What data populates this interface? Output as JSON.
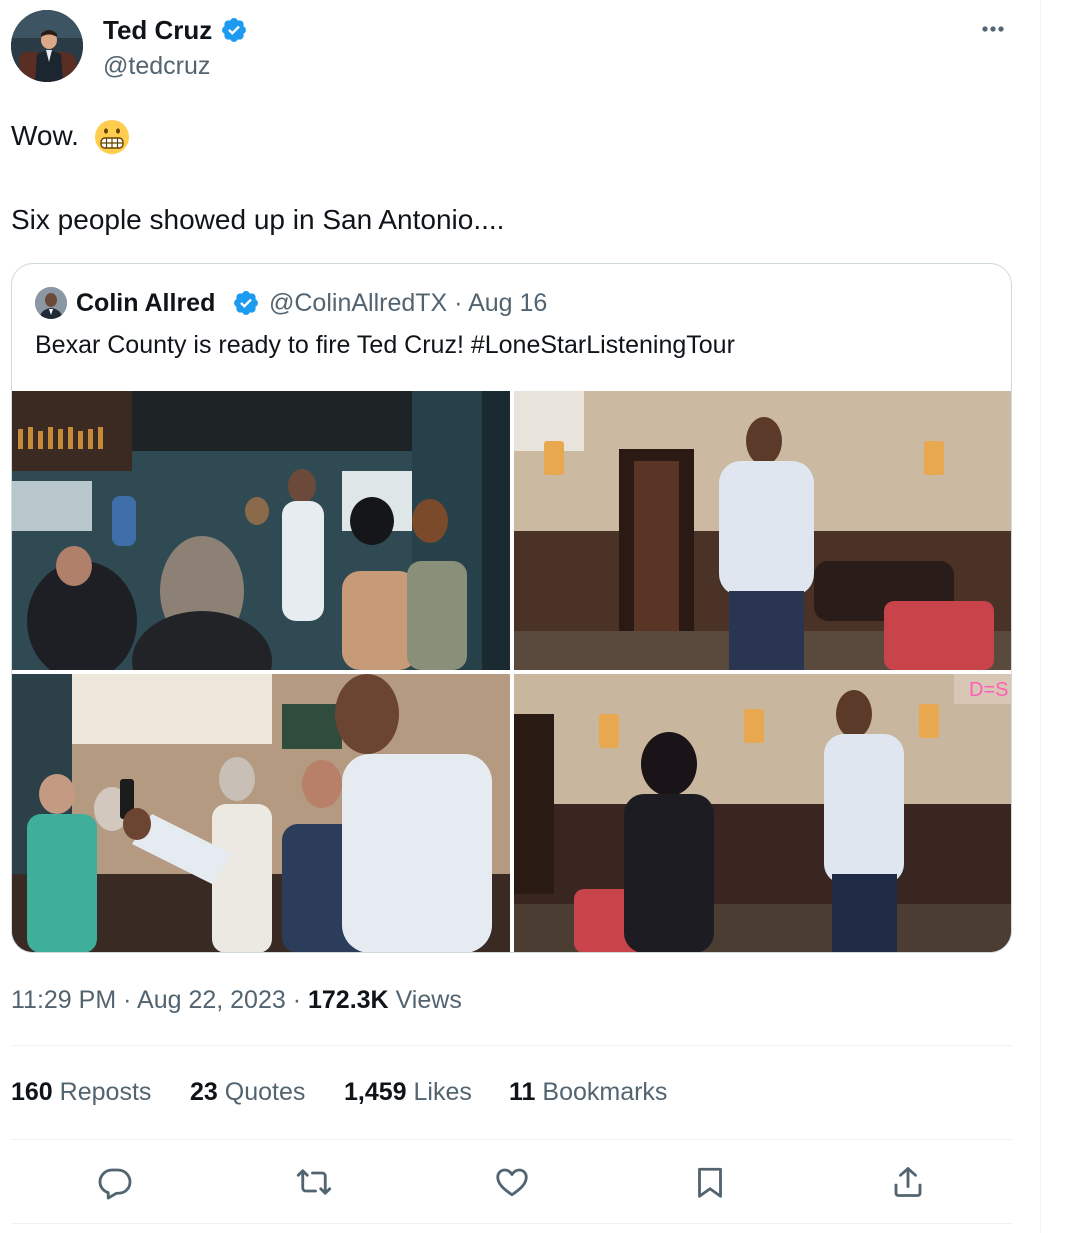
{
  "author": {
    "name": "Ted Cruz",
    "handle": "@tedcruz",
    "verified_color": "#1d9bf0"
  },
  "post": {
    "line1": "Wow.",
    "emoji": "grimacing-face",
    "line2": "Six people showed up in San Antonio...."
  },
  "quote": {
    "name": "Colin Allred",
    "handle": "@ColinAllredTX",
    "separator": "·",
    "date": "Aug 16",
    "text": "Bexar County is ready to fire Ted Cruz! #LoneStarListeningTour",
    "photos": [
      "campaign-event-crowd",
      "allred-speaking",
      "allred-selfie-with-supporters",
      "allred-talking-with-woman"
    ]
  },
  "meta": {
    "time": "11:29 PM",
    "sep1": "·",
    "date": "Aug 22, 2023",
    "sep2": "·",
    "views_count": "172.3K",
    "views_label": "Views"
  },
  "stats": {
    "reposts_count": "160",
    "reposts_label": "Reposts",
    "quotes_count": "23",
    "quotes_label": "Quotes",
    "likes_count": "1,459",
    "likes_label": "Likes",
    "bookmarks_count": "11",
    "bookmarks_label": "Bookmarks"
  },
  "actions": [
    "reply-icon",
    "repost-icon",
    "like-icon",
    "bookmark-icon",
    "share-icon"
  ],
  "colors": {
    "text": "#0f1419",
    "secondary": "#536471",
    "border": "#cfd9de",
    "divider": "#eff3f4",
    "accent": "#1d9bf0"
  }
}
